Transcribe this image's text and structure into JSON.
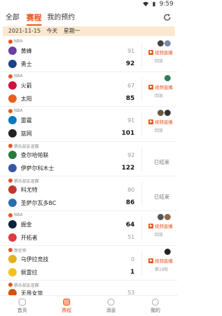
{
  "status_bar": {
    "time": "9:59"
  },
  "tabs": [
    {
      "label": "全部",
      "active": false
    },
    {
      "label": "赛程",
      "active": true
    },
    {
      "label": "我的预约",
      "active": false
    }
  ],
  "date_bar": {
    "date": "2021-11-15",
    "today": "今天",
    "weekday": "星期一"
  },
  "matches": [
    {
      "league": "NBA",
      "home": {
        "name": "黄蜂",
        "score": "91",
        "logo_color": "#6a3fa0"
      },
      "away": {
        "name": "勇士",
        "score": "92",
        "logo_color": "#1d428a"
      },
      "winner": "away",
      "video_label": "视频直播",
      "replay_label": "回放",
      "status": ""
    },
    {
      "league": "NBA",
      "home": {
        "name": "火箭",
        "score": "67",
        "logo_color": "#ce1141"
      },
      "away": {
        "name": "太阳",
        "score": "85",
        "logo_color": "#e56020"
      },
      "winner": "away",
      "video_label": "视频直播",
      "replay_label": "回放",
      "status": ""
    },
    {
      "league": "NBA",
      "home": {
        "name": "雷霆",
        "score": "91",
        "logo_color": "#007ac1"
      },
      "away": {
        "name": "篮网",
        "score": "101",
        "logo_color": "#222222"
      },
      "winner": "away",
      "video_label": "视频直播",
      "replay_label": "回放",
      "status": ""
    },
    {
      "league": "俱乐部友谊赛",
      "home": {
        "name": "查尔哈帕联",
        "score": "92",
        "logo_color": "#2b7a3d"
      },
      "away": {
        "name": "伊萨尔科木士",
        "score": "122",
        "logo_color": "#3a55a5"
      },
      "winner": "away",
      "video_label": "",
      "replay_label": "",
      "status": "已结束"
    },
    {
      "league": "俱乐部友谊赛",
      "home": {
        "name": "科尤特",
        "score": "80",
        "logo_color": "#c0392b"
      },
      "away": {
        "name": "圣萨尔瓦多BC",
        "score": "86",
        "logo_color": "#2a6fb0"
      },
      "winner": "away",
      "video_label": "",
      "replay_label": "",
      "status": "已结束"
    },
    {
      "league": "NBA",
      "home": {
        "name": "掘金",
        "score": "64",
        "logo_color": "#0e2240"
      },
      "away": {
        "name": "开拓者",
        "score": "51",
        "logo_color": "#e03a3e"
      },
      "winner": "home",
      "video_label": "视频直播",
      "replay_label": "回放",
      "status": ""
    },
    {
      "league": "哥伦甲",
      "home": {
        "name": "乌伊拉竞技",
        "score": "0",
        "logo_color": "#e3b11b"
      },
      "away": {
        "name": "佩雷拉",
        "score": "1",
        "logo_color": "#f2c21b"
      },
      "winner": "away",
      "video_label": "视频直播",
      "replay_label": "第19轮",
      "status": ""
    },
    {
      "league": "俱乐部友谊赛",
      "home": {
        "name": "无畏女篮",
        "score": "53",
        "logo_color": "#d35400"
      },
      "away": {
        "name": "",
        "score": "",
        "logo_color": "#ffffff"
      },
      "winner": "",
      "video_label": "",
      "replay_label": "",
      "status": ""
    }
  ],
  "bottom_nav": [
    {
      "label": "首页",
      "active": false
    },
    {
      "label": "赛程",
      "active": true
    },
    {
      "label": "消息",
      "active": false
    },
    {
      "label": "我的",
      "active": false
    }
  ],
  "colors": {
    "accent": "#e8541e",
    "date_bar_bg": "#fbe8cf"
  }
}
